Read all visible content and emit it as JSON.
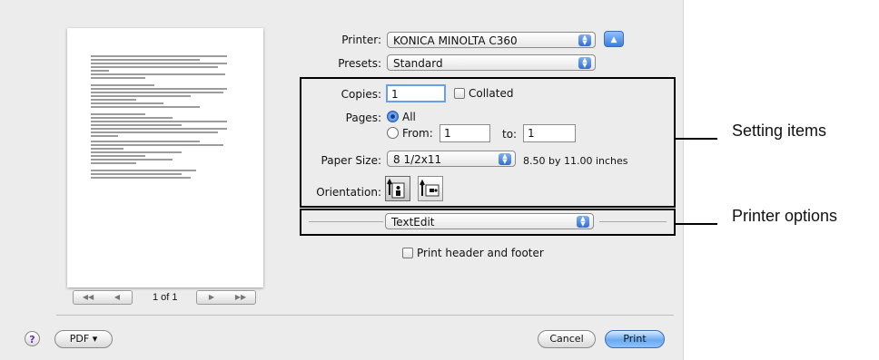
{
  "printer": {
    "label": "Printer:",
    "value": "KONICA MINOLTA C360"
  },
  "presets": {
    "label": "Presets:",
    "value": "Standard"
  },
  "copies": {
    "label": "Copies:",
    "value": "1",
    "collated_label": "Collated"
  },
  "pages": {
    "label": "Pages:",
    "all_label": "All",
    "from_label": "From:",
    "from_value": "1",
    "to_label": "to:",
    "to_value": "1"
  },
  "paper_size": {
    "label": "Paper Size:",
    "value": "8 1/2x11",
    "dimensions": "8.50 by 11.00 inches"
  },
  "orientation": {
    "label": "Orientation:"
  },
  "options_menu": {
    "value": "TextEdit"
  },
  "print_header_footer": {
    "label": "Print header and footer"
  },
  "preview": {
    "page_count": "1 of 1"
  },
  "buttons": {
    "help": "?",
    "pdf": "PDF ▾",
    "cancel": "Cancel",
    "print": "Print"
  },
  "callouts": {
    "setting_items": "Setting items",
    "printer_options": "Printer options"
  },
  "colors": {
    "dialog_bg": "#ececec",
    "accent": "#3e7be0"
  }
}
